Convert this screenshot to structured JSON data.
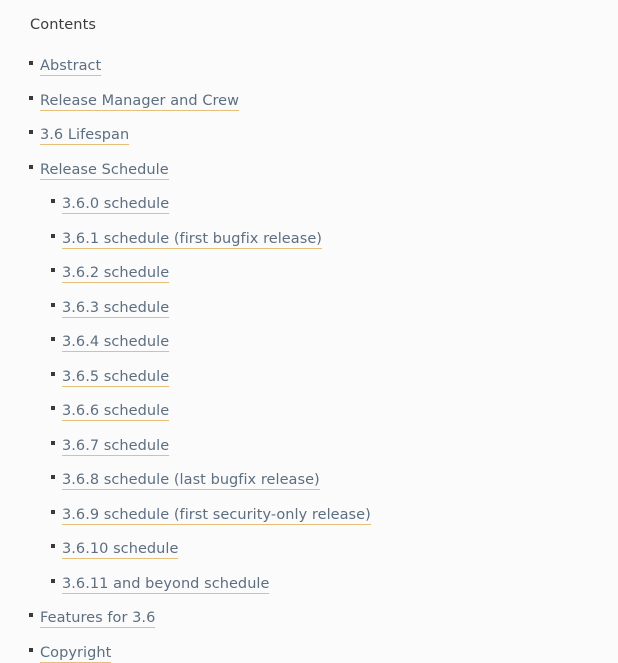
{
  "toc": {
    "heading": "Contents",
    "items": [
      {
        "label": "Abstract"
      },
      {
        "label": "Release Manager and Crew"
      },
      {
        "label": "3.6 Lifespan"
      },
      {
        "label": "Release Schedule",
        "children": [
          {
            "label": "3.6.0 schedule"
          },
          {
            "label": "3.6.1 schedule (first bugfix release)"
          },
          {
            "label": "3.6.2 schedule"
          },
          {
            "label": "3.6.3 schedule"
          },
          {
            "label": "3.6.4 schedule"
          },
          {
            "label": "3.6.5 schedule"
          },
          {
            "label": "3.6.6 schedule"
          },
          {
            "label": "3.6.7 schedule"
          },
          {
            "label": "3.6.8 schedule (last bugfix release)"
          },
          {
            "label": "3.6.9 schedule (first security-only release)"
          },
          {
            "label": "3.6.10 schedule"
          },
          {
            "label": "3.6.11 and beyond schedule"
          }
        ]
      },
      {
        "label": "Features for 3.6"
      },
      {
        "label": "Copyright"
      }
    ]
  },
  "colors": {
    "background": "#fbfbfb",
    "heading_text": "#3d3d3d",
    "link_text": "#5c6f81",
    "link_underline": "#e5c07b",
    "bullet": "#3a3a3a"
  }
}
